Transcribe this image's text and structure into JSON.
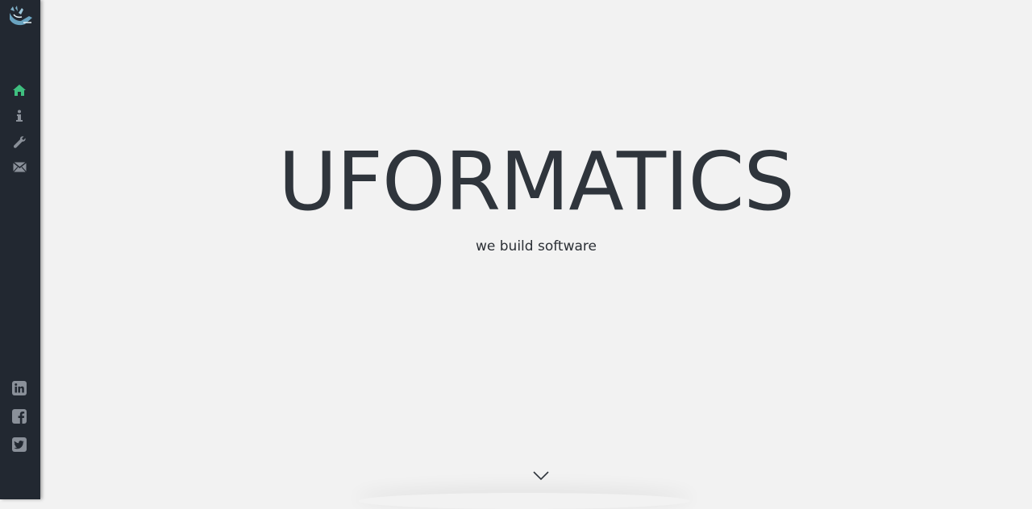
{
  "brand": {
    "name": "UFORMATICS",
    "tagline": "we build software",
    "logo_icon": "ufo-hand-logo-icon"
  },
  "sidebar": {
    "nav": [
      {
        "id": "home",
        "icon": "home-icon",
        "active": true
      },
      {
        "id": "about",
        "icon": "info-icon",
        "active": false
      },
      {
        "id": "services",
        "icon": "wrench-icon",
        "active": false
      },
      {
        "id": "contact",
        "icon": "envelope-icon",
        "active": false
      }
    ],
    "social": [
      {
        "id": "linkedin",
        "icon": "linkedin-icon"
      },
      {
        "id": "facebook",
        "icon": "facebook-icon"
      },
      {
        "id": "twitter",
        "icon": "twitter-icon"
      }
    ]
  },
  "scroll_hint": {
    "icon": "chevron-down-icon"
  },
  "colors": {
    "sidebar_bg": "#222831",
    "page_bg": "#f2f2f2",
    "accent": "#3fbf7f",
    "icon_muted": "#8a9099",
    "text_dark": "#2f353c"
  }
}
